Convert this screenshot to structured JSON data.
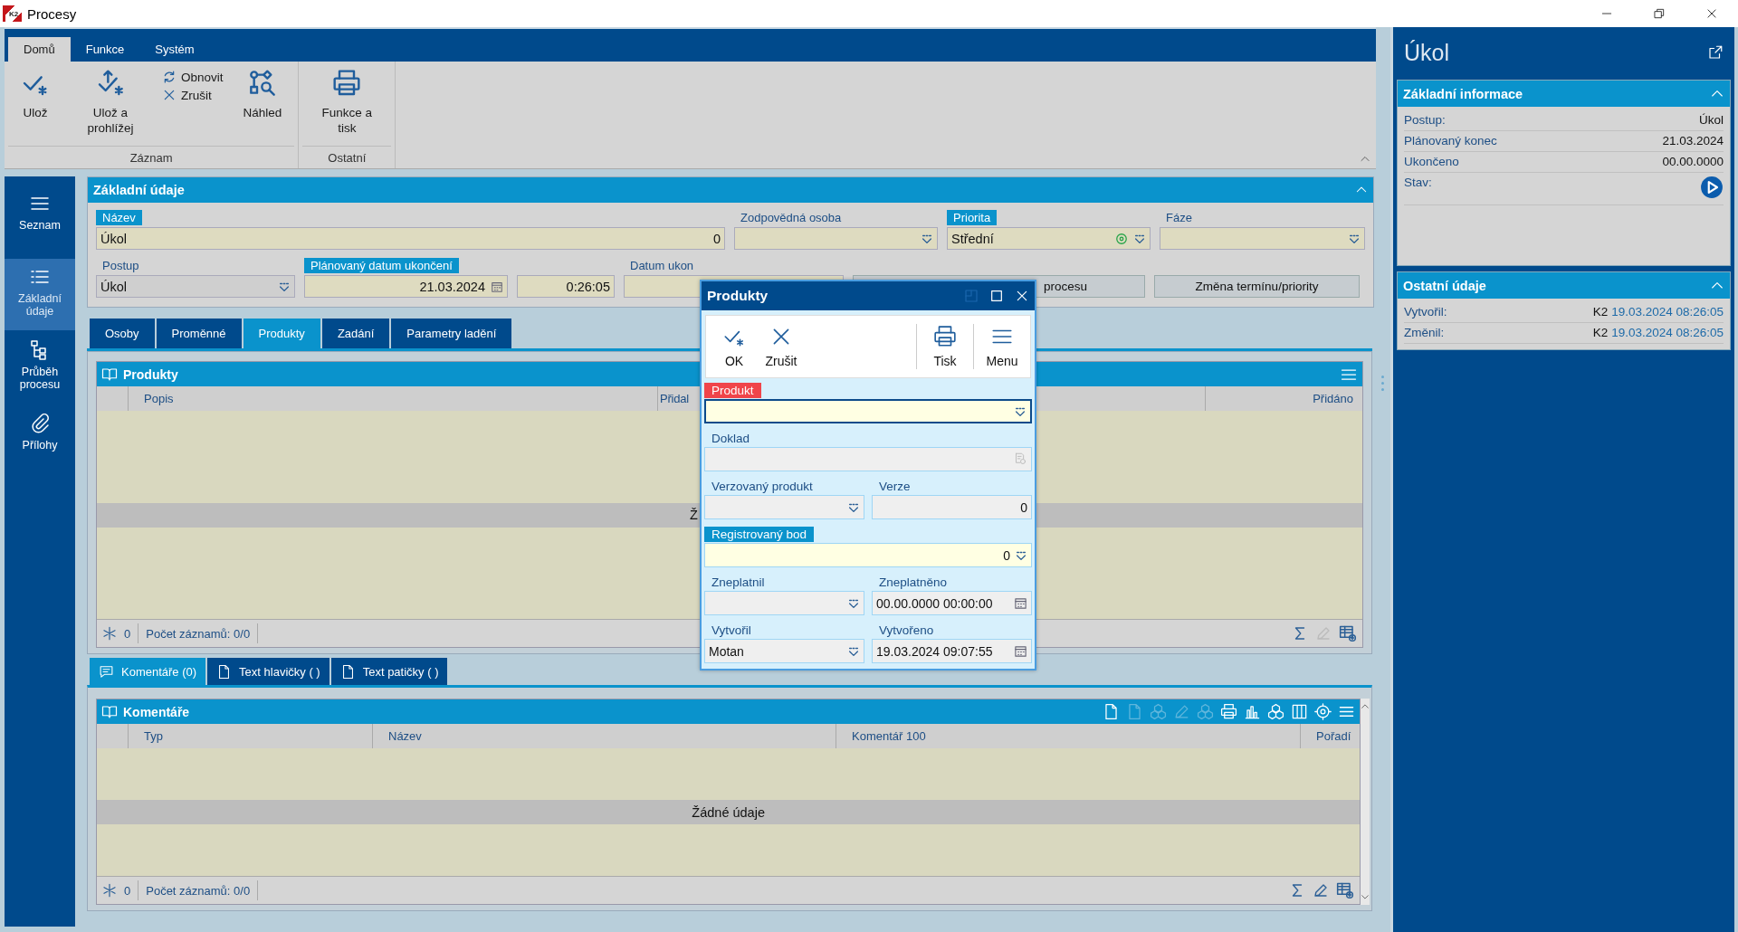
{
  "window": {
    "logo": "K2",
    "title": "Procesy"
  },
  "ribbon": {
    "tabs": [
      {
        "label": "Domů",
        "selected": true
      },
      {
        "label": "Funkce",
        "selected": false
      },
      {
        "label": "Systém",
        "selected": false
      }
    ],
    "groups": [
      {
        "label": "Záznam",
        "buttons": [
          {
            "kind": "large",
            "label": "Ulož"
          },
          {
            "kind": "large",
            "label": "Ulož a prohlížej"
          },
          {
            "kind": "small",
            "label": "Obnovit"
          },
          {
            "kind": "small",
            "label": "Zrušit"
          },
          {
            "kind": "large",
            "label": "Náhled"
          }
        ]
      },
      {
        "label": "Ostatní",
        "buttons": [
          {
            "kind": "large",
            "label": "Funkce a tisk"
          }
        ]
      }
    ]
  },
  "nav": [
    {
      "label": "Seznam",
      "selected": false
    },
    {
      "label": "Základní údaje",
      "selected": true
    },
    {
      "label": "Průběh procesu",
      "selected": false
    },
    {
      "label": "Přílohy",
      "selected": false
    }
  ],
  "basic": {
    "title": "Základní údaje",
    "fields": [
      {
        "kind": "text",
        "label": "Název",
        "value": "Úkol",
        "number": "0",
        "required": true,
        "disabled": false
      },
      {
        "kind": "combo",
        "label": "Zodpovědná osoba",
        "required": false,
        "disabled": false
      },
      {
        "kind": "priority",
        "label": "Priorita",
        "value": "Střední",
        "required": true,
        "disabled": false
      },
      {
        "kind": "combo",
        "label": "Fáze",
        "required": false,
        "disabled": false
      },
      {
        "kind": "combo",
        "label": "Postup",
        "value": "Úkol",
        "required": false,
        "disabled": true
      },
      {
        "kind": "date",
        "label": "Plánovaný datum ukončení",
        "value": "21.03.2024",
        "required": true,
        "disabled": false
      },
      {
        "kind": "time",
        "value": "0:26:05",
        "required": false,
        "disabled": false
      },
      {
        "kind": "text",
        "label": "Datum ukon",
        "required": false,
        "disabled": false
      },
      {
        "kind": "button",
        "label": "procesu"
      },
      {
        "kind": "button",
        "label": "Změna termínu/priority"
      }
    ]
  },
  "tabs": [
    {
      "label": "Osoby",
      "selected": false
    },
    {
      "label": "Proměnné",
      "selected": false
    },
    {
      "label": "Produkty",
      "selected": true
    },
    {
      "label": "Zadání",
      "selected": false
    },
    {
      "label": "Parametry ladění",
      "selected": false
    }
  ],
  "products_grid": {
    "title": "Produkty",
    "columns": [
      "Popis",
      "Přidal",
      "Přidáno"
    ],
    "empty_text": "Ž",
    "count": "0",
    "records": "Počet záznamů: 0/0"
  },
  "bottom_tabs": [
    {
      "label": "Komentáře (0)",
      "selected": true
    },
    {
      "label": "Text hlavičky ( )",
      "selected": false
    },
    {
      "label": "Text patičky ( )",
      "selected": false
    }
  ],
  "comments_grid": {
    "title": "Komentáře",
    "columns": [
      "Typ",
      "Název",
      "Komentář 100",
      "Pořadí"
    ],
    "empty_text": "Žádné údaje",
    "count": "0",
    "records": "Počet záznamů: 0/0"
  },
  "side": {
    "title": "Úkol",
    "sections": [
      {
        "title": "Základní informace",
        "expanded": true,
        "rows": [
          {
            "kind": "text",
            "label": "Postup:",
            "value": "Úkol"
          },
          {
            "kind": "text",
            "label": "Plánovaný konec",
            "value": "21.03.2024"
          },
          {
            "kind": "text",
            "label": "Ukončeno",
            "value": "00.00.0000"
          },
          {
            "kind": "status",
            "label": "Stav:"
          }
        ]
      },
      {
        "title": "Ostatní údaje",
        "expanded": true,
        "rows": [
          {
            "kind": "audit",
            "label": "Vytvořil:",
            "user": "K2",
            "value": "19.03.2024 08:26:05"
          },
          {
            "kind": "audit",
            "label": "Změnil:",
            "user": "K2",
            "value": "19.03.2024 08:26:05"
          }
        ]
      }
    ]
  },
  "dialog": {
    "title": "Produkty",
    "toolbar": [
      {
        "label": "OK"
      },
      {
        "label": "Zrušit"
      },
      {
        "label": "Tisk"
      },
      {
        "label": "Menu"
      }
    ],
    "rows": [
      [
        {
          "kind": "combo",
          "label": "Produkt",
          "required": true,
          "missing": true
        }
      ],
      [
        {
          "kind": "lookup",
          "label": "Doklad",
          "required": false,
          "missing": false
        }
      ],
      [
        {
          "kind": "combo",
          "label": "Verzovaný produkt",
          "required": false,
          "missing": false
        },
        {
          "kind": "text",
          "label": "Verze",
          "value": "0",
          "required": false,
          "missing": false
        }
      ],
      [
        {
          "kind": "combo",
          "label": "Registrovaný bod",
          "value": "0",
          "required": true,
          "missing": false
        }
      ],
      [
        {
          "kind": "combo",
          "label": "Zneplatnil",
          "required": false,
          "missing": false
        },
        {
          "kind": "date",
          "label": "Zneplatněno",
          "value": "00.00.0000 00:00:00",
          "required": false,
          "missing": false
        }
      ],
      [
        {
          "kind": "combo",
          "label": "Vytvořil",
          "value": "Motan",
          "required": false,
          "missing": false
        },
        {
          "kind": "date",
          "label": "Vytvořeno",
          "value": "19.03.2024 09:07:55",
          "required": false,
          "missing": false
        }
      ]
    ]
  }
}
